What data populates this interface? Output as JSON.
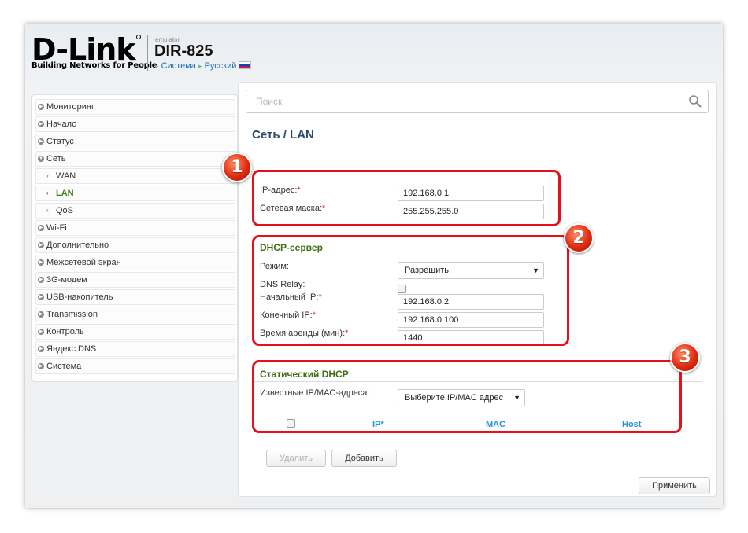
{
  "header": {
    "logo": "D-Link",
    "tagline": "Building Networks for People",
    "emulator": "emulator",
    "model": "DIR-825",
    "links": [
      "Система",
      "Русский"
    ]
  },
  "search": {
    "placeholder": "Поиск"
  },
  "sidebar": {
    "items": [
      {
        "label": "Мониторинг"
      },
      {
        "label": "Начало"
      },
      {
        "label": "Статус"
      },
      {
        "label": "Сеть"
      },
      {
        "label": "WAN"
      },
      {
        "label": "LAN"
      },
      {
        "label": "QoS"
      },
      {
        "label": "Wi-Fi"
      },
      {
        "label": "Дополнительно"
      },
      {
        "label": "Межсетевой экран"
      },
      {
        "label": "3G-модем"
      },
      {
        "label": "USB-накопитель"
      },
      {
        "label": "Transmission"
      },
      {
        "label": "Контроль"
      },
      {
        "label": "Яндекс.DNS"
      },
      {
        "label": "Система"
      }
    ]
  },
  "page": {
    "title": "Сеть /  LAN"
  },
  "lan": {
    "ip_label": "IP-адрес:",
    "ip_value": "192.168.0.1",
    "mask_label": "Сетевая маска:",
    "mask_value": "255.255.255.0"
  },
  "dhcp": {
    "title": "DHCP-сервер",
    "mode_label": "Режим:",
    "mode_value": "Разрешить",
    "relay_label": "DNS Relay:",
    "start_label": "Начальный IP:",
    "start_value": "192.168.0.2",
    "end_label": "Конечный IP:",
    "end_value": "192.168.0.100",
    "lease_label": "Время аренды (мин):",
    "lease_value": "1440"
  },
  "static": {
    "title": "Статический DHCP",
    "known_label": "Известные IP/MAC-адреса:",
    "known_value": "Выберите IP/MAC адрес",
    "col_ip": "IP*",
    "col_mac": "MAC",
    "col_host": "Host"
  },
  "buttons": {
    "delete": "Удалить",
    "add": "Добавить",
    "apply": "Применить"
  },
  "callouts": [
    "1",
    "2",
    "3"
  ],
  "required_mark": "*",
  "colors": {
    "accent_green": "#3d6f12",
    "link_blue": "#2a93d5",
    "callout_red": "#e5101c"
  }
}
